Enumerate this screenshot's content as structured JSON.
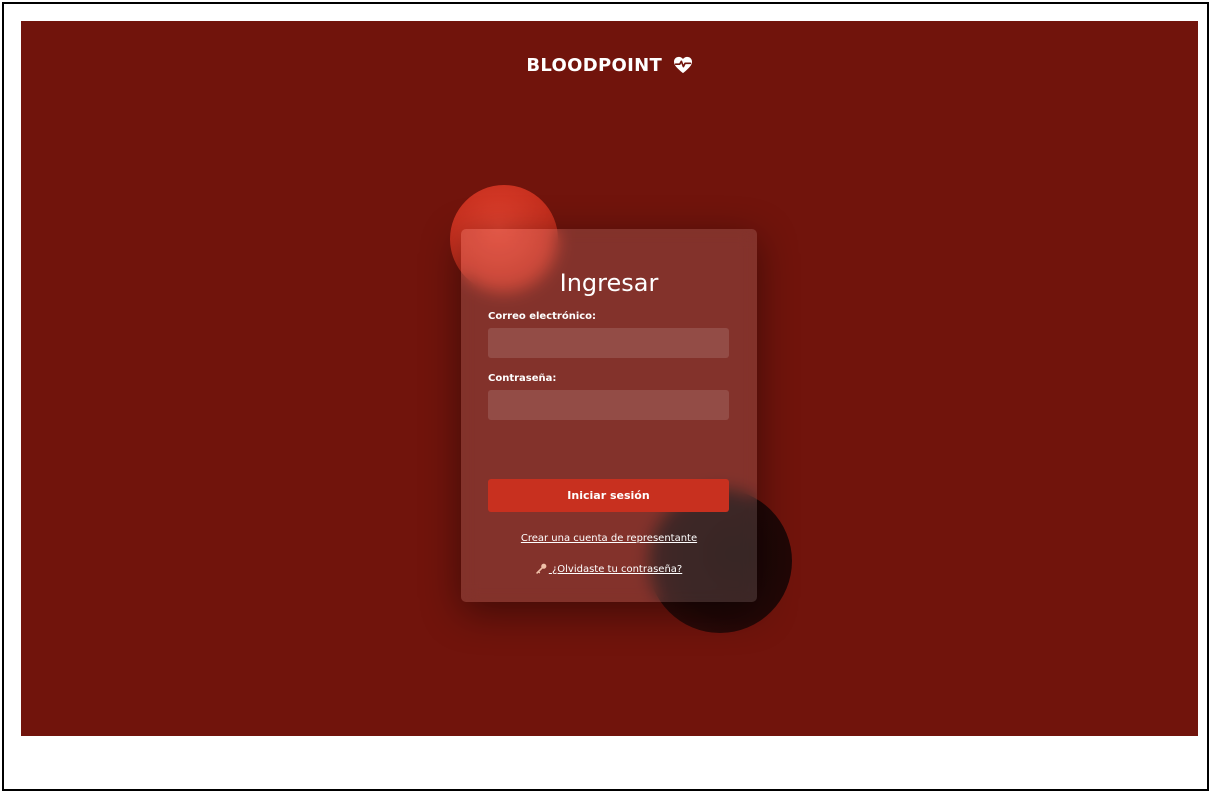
{
  "app": {
    "brand": "BLOODPOINT",
    "brand_icon": "heart-pulse-icon"
  },
  "login": {
    "title": "Ingresar",
    "email_label": "Correo electrónico:",
    "email_value": "",
    "password_label": "Contraseña:",
    "password_value": "",
    "submit_label": "Iniciar sesión",
    "register_link": "Crear una cuenta de representante",
    "forgot_link": "¿Olvidaste tu contraseña?",
    "forgot_icon": "key-icon"
  },
  "colors": {
    "background": "#71140c",
    "accent": "#c8301f"
  }
}
